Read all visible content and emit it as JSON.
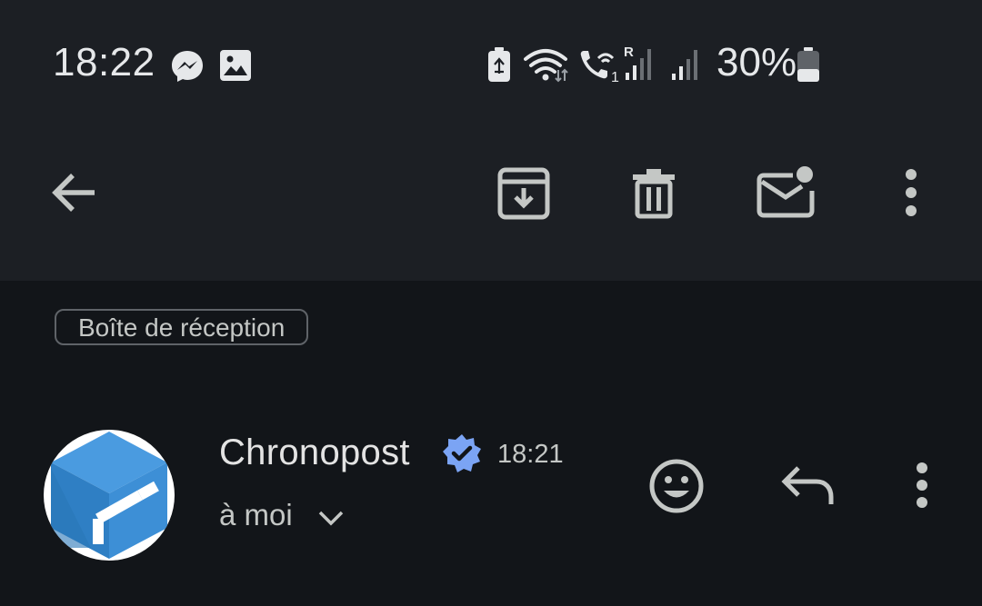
{
  "status_bar": {
    "time": "18:22",
    "battery_percent": "30%",
    "battery_level": 0.3,
    "notification_icons": [
      "messenger-icon",
      "image-icon"
    ],
    "system_icons": [
      "battery-saver-icon",
      "wifi-icon",
      "wifi-call-icon",
      "signal-roaming-icon",
      "signal-icon",
      "battery-icon"
    ]
  },
  "toolbar": {
    "icons": [
      "back-arrow-icon",
      "archive-icon",
      "delete-icon",
      "mark-unread-icon",
      "more-vert-icon"
    ]
  },
  "label": "Boîte de réception",
  "message": {
    "sender": "Chronopost",
    "verified": true,
    "time": "18:21",
    "recipient": "à moi",
    "actions": [
      "emoji-react-icon",
      "reply-icon",
      "more-vert-icon"
    ]
  },
  "colors": {
    "toolbar_bg": "#1c1f24",
    "page_bg": "#121519",
    "text_primary": "#e3e3e3",
    "text_secondary": "#c4c7c5",
    "verified_blue": "#7ba4f4",
    "avatar_blue": "#3d8fd6"
  }
}
